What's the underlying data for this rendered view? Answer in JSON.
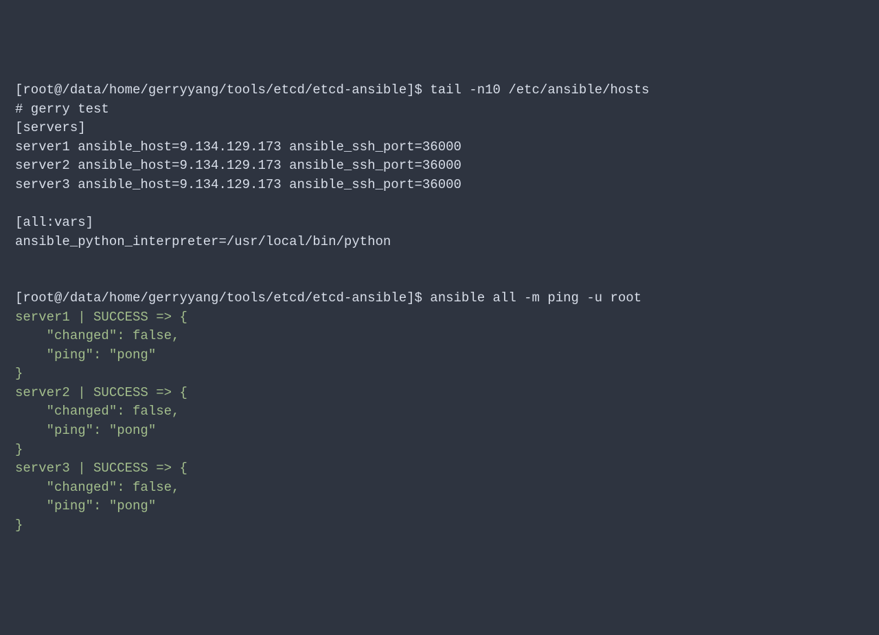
{
  "terminal": {
    "lines": [
      {
        "text": "[root@/data/home/gerryyang/tools/etcd/etcd-ansible]$ tail -n10 /etc/ansible/hosts",
        "color": "default"
      },
      {
        "text": "# gerry test",
        "color": "default"
      },
      {
        "text": "[servers]",
        "color": "default"
      },
      {
        "text": "server1 ansible_host=9.134.129.173 ansible_ssh_port=36000",
        "color": "default"
      },
      {
        "text": "server2 ansible_host=9.134.129.173 ansible_ssh_port=36000",
        "color": "default"
      },
      {
        "text": "server3 ansible_host=9.134.129.173 ansible_ssh_port=36000",
        "color": "default"
      },
      {
        "text": " ",
        "color": "default"
      },
      {
        "text": "[all:vars]",
        "color": "default"
      },
      {
        "text": "ansible_python_interpreter=/usr/local/bin/python",
        "color": "default"
      },
      {
        "text": " ",
        "color": "default"
      },
      {
        "text": " ",
        "color": "default"
      },
      {
        "text": "[root@/data/home/gerryyang/tools/etcd/etcd-ansible]$ ansible all -m ping -u root",
        "color": "default"
      },
      {
        "text": "server1 | SUCCESS => {",
        "color": "green"
      },
      {
        "text": "    \"changed\": false,",
        "color": "green"
      },
      {
        "text": "    \"ping\": \"pong\"",
        "color": "green"
      },
      {
        "text": "}",
        "color": "green"
      },
      {
        "text": "server2 | SUCCESS => {",
        "color": "green"
      },
      {
        "text": "    \"changed\": false,",
        "color": "green"
      },
      {
        "text": "    \"ping\": \"pong\"",
        "color": "green"
      },
      {
        "text": "}",
        "color": "green"
      },
      {
        "text": "server3 | SUCCESS => {",
        "color": "green"
      },
      {
        "text": "    \"changed\": false,",
        "color": "green"
      },
      {
        "text": "    \"ping\": \"pong\"",
        "color": "green"
      },
      {
        "text": "}",
        "color": "green"
      }
    ]
  }
}
